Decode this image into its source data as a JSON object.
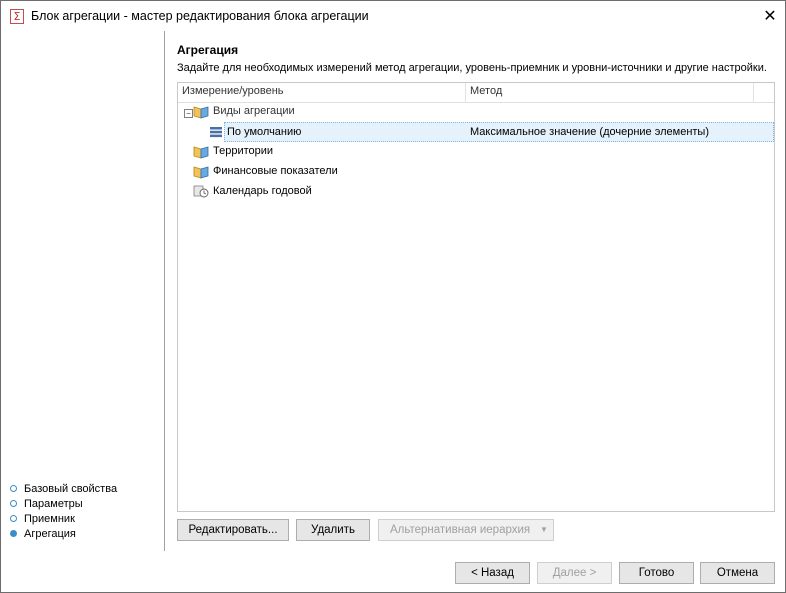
{
  "window": {
    "title": "Блок агрегации - мастер редактирования блока агрегации",
    "app_icon_glyph": "Σ",
    "close_glyph": "✕"
  },
  "nav": {
    "items": [
      {
        "label": "Базовый свойства",
        "active": false
      },
      {
        "label": "Параметры",
        "active": false
      },
      {
        "label": "Приемник",
        "active": false
      },
      {
        "label": "Агрегация",
        "active": true
      }
    ]
  },
  "page": {
    "title": "Агрегация",
    "description": "Задайте для необходимых измерений метод агрегации, уровень-приемник и уровни-источники и другие настройки."
  },
  "grid": {
    "columns": [
      "Измерение/уровень",
      "Метод"
    ],
    "rows": [
      {
        "name": "Виды агрегации",
        "method": "",
        "icon": "dictionary-icon",
        "expanded": true
      },
      {
        "name": "По умолчанию",
        "method": "Максимальное значение (дочерние элементы)",
        "icon": "level-icon",
        "selected": true
      },
      {
        "name": "Территории",
        "method": "",
        "icon": "dictionary-icon"
      },
      {
        "name": "Финансовые показатели",
        "method": "",
        "icon": "dictionary-icon"
      },
      {
        "name": "Календарь годовой",
        "method": "",
        "icon": "calendar-dictionary-icon"
      }
    ],
    "expander_glyph": "−"
  },
  "actions": {
    "edit": "Редактировать...",
    "delete": "Удалить",
    "alt_hierarchy": "Альтернативная иерархия",
    "dropdown_glyph": "▼"
  },
  "footer": {
    "back": "< Назад",
    "next": "Далее >",
    "finish": "Готово",
    "cancel": "Отмена"
  }
}
